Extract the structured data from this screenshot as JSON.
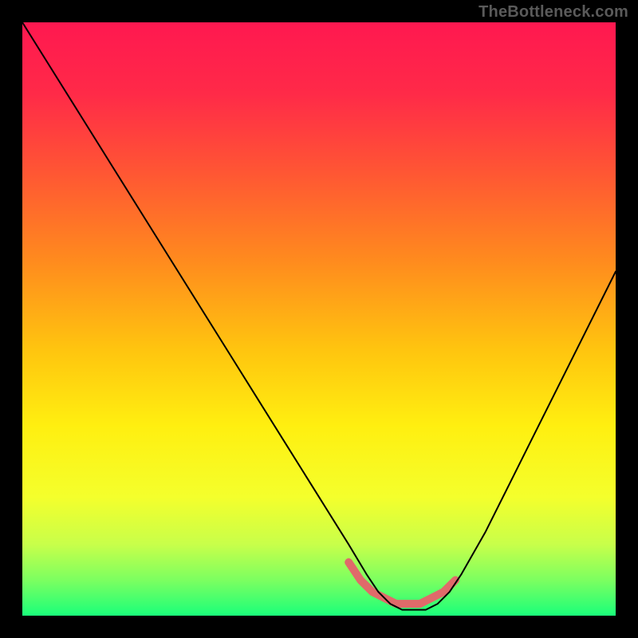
{
  "watermark": "TheBottleneck.com",
  "colors": {
    "frame": "#000000",
    "gradient_stops": [
      {
        "pos": 0.0,
        "color": "#ff1850"
      },
      {
        "pos": 0.12,
        "color": "#ff2a48"
      },
      {
        "pos": 0.25,
        "color": "#ff5534"
      },
      {
        "pos": 0.4,
        "color": "#ff8a1e"
      },
      {
        "pos": 0.55,
        "color": "#ffc40f"
      },
      {
        "pos": 0.68,
        "color": "#ffef10"
      },
      {
        "pos": 0.8,
        "color": "#f4ff2c"
      },
      {
        "pos": 0.88,
        "color": "#c8ff4a"
      },
      {
        "pos": 0.94,
        "color": "#7cff60"
      },
      {
        "pos": 1.0,
        "color": "#1aff7a"
      }
    ],
    "curve": "#000000",
    "highlight": "#e06a6a"
  },
  "chart_data": {
    "type": "line",
    "title": "",
    "xlabel": "",
    "ylabel": "",
    "x": [
      0.0,
      0.05,
      0.1,
      0.15,
      0.2,
      0.25,
      0.3,
      0.35,
      0.4,
      0.45,
      0.5,
      0.55,
      0.58,
      0.6,
      0.62,
      0.64,
      0.66,
      0.68,
      0.7,
      0.72,
      0.74,
      0.78,
      0.82,
      0.86,
      0.9,
      0.95,
      1.0
    ],
    "values": [
      1.0,
      0.92,
      0.84,
      0.76,
      0.68,
      0.6,
      0.52,
      0.44,
      0.36,
      0.28,
      0.2,
      0.12,
      0.07,
      0.04,
      0.02,
      0.01,
      0.01,
      0.01,
      0.02,
      0.04,
      0.07,
      0.14,
      0.22,
      0.3,
      0.38,
      0.48,
      0.58
    ],
    "xlim": [
      0,
      1
    ],
    "ylim": [
      0,
      1
    ],
    "series": [
      {
        "name": "bottleneck-curve",
        "color": "#000000",
        "stroke_width": 2
      },
      {
        "name": "optimal-range-highlight",
        "color": "#e06a6a",
        "stroke_width": 10,
        "x": [
          0.55,
          0.57,
          0.59,
          0.61,
          0.63,
          0.65,
          0.67,
          0.69,
          0.71,
          0.73
        ],
        "values": [
          0.09,
          0.06,
          0.04,
          0.03,
          0.02,
          0.02,
          0.02,
          0.03,
          0.04,
          0.06
        ]
      }
    ]
  }
}
